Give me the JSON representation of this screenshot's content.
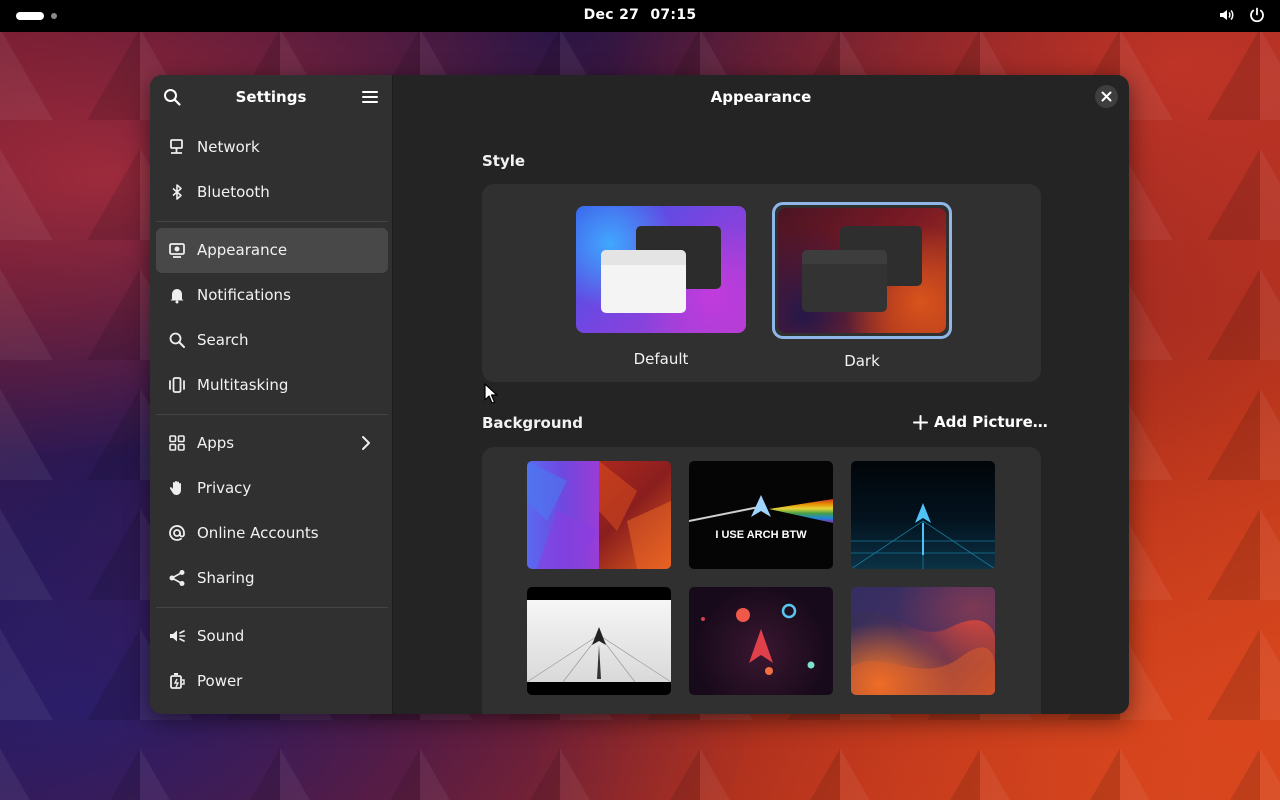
{
  "topbar": {
    "date": "Dec 27",
    "time": "07:15"
  },
  "sidebar": {
    "title": "Settings",
    "groups": [
      [
        {
          "label": "Network",
          "icon": "network-icon"
        },
        {
          "label": "Bluetooth",
          "icon": "bluetooth-icon"
        }
      ],
      [
        {
          "label": "Appearance",
          "icon": "appearance-icon",
          "active": true
        },
        {
          "label": "Notifications",
          "icon": "bell-icon"
        },
        {
          "label": "Search",
          "icon": "search-icon"
        },
        {
          "label": "Multitasking",
          "icon": "multitasking-icon"
        }
      ],
      [
        {
          "label": "Apps",
          "icon": "apps-icon",
          "has_submenu": true
        },
        {
          "label": "Privacy",
          "icon": "hand-icon"
        },
        {
          "label": "Online Accounts",
          "icon": "at-icon"
        },
        {
          "label": "Sharing",
          "icon": "share-icon"
        }
      ],
      [
        {
          "label": "Sound",
          "icon": "speaker-icon"
        },
        {
          "label": "Power",
          "icon": "battery-icon"
        }
      ]
    ]
  },
  "content": {
    "title": "Appearance",
    "style": {
      "heading": "Style",
      "options": [
        {
          "label": "Default",
          "selected": false
        },
        {
          "label": "Dark",
          "selected": true
        }
      ],
      "selected_color": "#8eb6e8"
    },
    "background": {
      "heading": "Background",
      "add_label": "Add Picture…",
      "wallpapers": [
        {
          "name": "geometric-blue-red"
        },
        {
          "name": "arch-prism",
          "caption": "I USE ARCH BTW"
        },
        {
          "name": "arch-synthwave-grid"
        },
        {
          "name": "arch-white-road"
        },
        {
          "name": "arch-space-planets"
        },
        {
          "name": "abstract-waves"
        }
      ]
    }
  }
}
